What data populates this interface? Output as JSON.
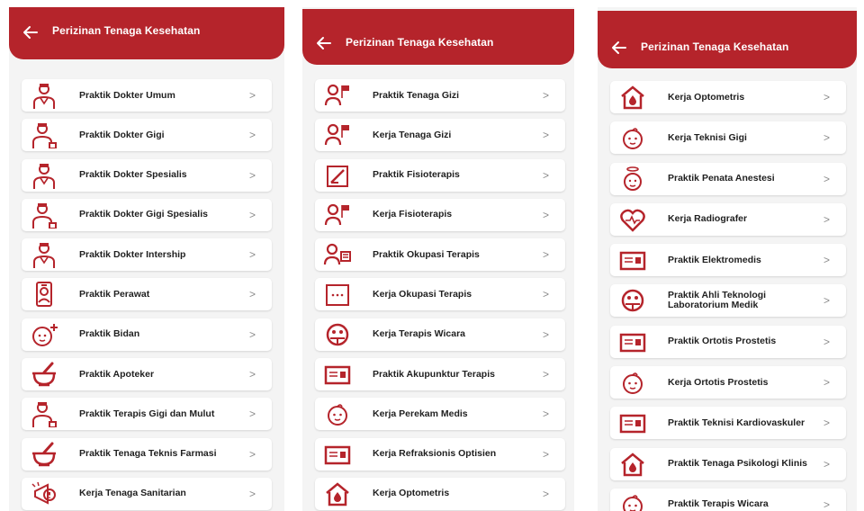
{
  "accent": "#b5242b",
  "panels": [
    {
      "title": "Perizinan Tenaga Kesehatan",
      "items": [
        {
          "label": "Praktik Dokter Umum",
          "icon": "doctor-icon"
        },
        {
          "label": "Praktik Dokter Gigi",
          "icon": "dentist-icon"
        },
        {
          "label": "Praktik Dokter Spesialis",
          "icon": "doctor-icon"
        },
        {
          "label": "Praktik Dokter Gigi Spesialis",
          "icon": "dentist-icon"
        },
        {
          "label": "Praktik Dokter Intership",
          "icon": "doctor-icon"
        },
        {
          "label": "Praktik Perawat",
          "icon": "nurse-icon"
        },
        {
          "label": "Praktik Bidan",
          "icon": "baby-plus-icon"
        },
        {
          "label": "Praktik Apoteker",
          "icon": "mortar-pestle-icon"
        },
        {
          "label": "Praktik Terapis Gigi dan Mulut",
          "icon": "dentist-icon"
        },
        {
          "label": "Praktik Tenaga Teknis Farmasi",
          "icon": "mortar-pestle-icon"
        },
        {
          "label": "Kerja Tenaga Sanitarian",
          "icon": "megaphone-alert-icon"
        }
      ]
    },
    {
      "title": "Perizinan Tenaga Kesehatan",
      "items": [
        {
          "label": "Praktik Tenaga Gizi",
          "icon": "person-flag-icon"
        },
        {
          "label": "Kerja Tenaga Gizi",
          "icon": "person-flag-icon"
        },
        {
          "label": "Praktik Fisioterapis",
          "icon": "edit-square-icon"
        },
        {
          "label": "Kerja Fisioterapis",
          "icon": "person-flag-icon"
        },
        {
          "label": "Praktik Okupasi Terapis",
          "icon": "person-board-icon"
        },
        {
          "label": "Kerja Okupasi Terapis",
          "icon": "dots-square-icon"
        },
        {
          "label": "Kerja Terapis Wicara",
          "icon": "face-circle-icon"
        },
        {
          "label": "Praktik Akupunktur Terapis",
          "icon": "id-card-icon"
        },
        {
          "label": "Kerja Perekam Medis",
          "icon": "baby-face-icon"
        },
        {
          "label": "Kerja Refraksionis Optisien",
          "icon": "id-card-icon"
        },
        {
          "label": "Kerja Optometris",
          "icon": "house-drop-icon"
        }
      ]
    },
    {
      "title": "Perizinan Tenaga Kesehatan",
      "items": [
        {
          "label": "Kerja Optometris",
          "icon": "house-drop-icon"
        },
        {
          "label": "Kerja Teknisi Gigi",
          "icon": "baby-face-icon"
        },
        {
          "label": "Praktik Penata Anestesi",
          "icon": "baby-halo-icon"
        },
        {
          "label": "Kerja Radiografer",
          "icon": "heart-pulse-icon"
        },
        {
          "label": "Praktik Elektromedis",
          "icon": "id-card-icon"
        },
        {
          "label": "Praktik Ahli Teknologi\nLaboratorium Medik",
          "icon": "face-circle-icon"
        },
        {
          "label": "Praktik Ortotis Prostetis",
          "icon": "id-card-icon"
        },
        {
          "label": "Kerja Ortotis Prostetis",
          "icon": "baby-face-icon"
        },
        {
          "label": "Praktik Teknisi Kardiovaskuler",
          "icon": "id-card-icon"
        },
        {
          "label": "Praktik Tenaga Psikologi Klinis",
          "icon": "house-drop-icon"
        },
        {
          "label": "Praktik Terapis Wicara",
          "icon": "baby-face-icon"
        }
      ]
    }
  ]
}
